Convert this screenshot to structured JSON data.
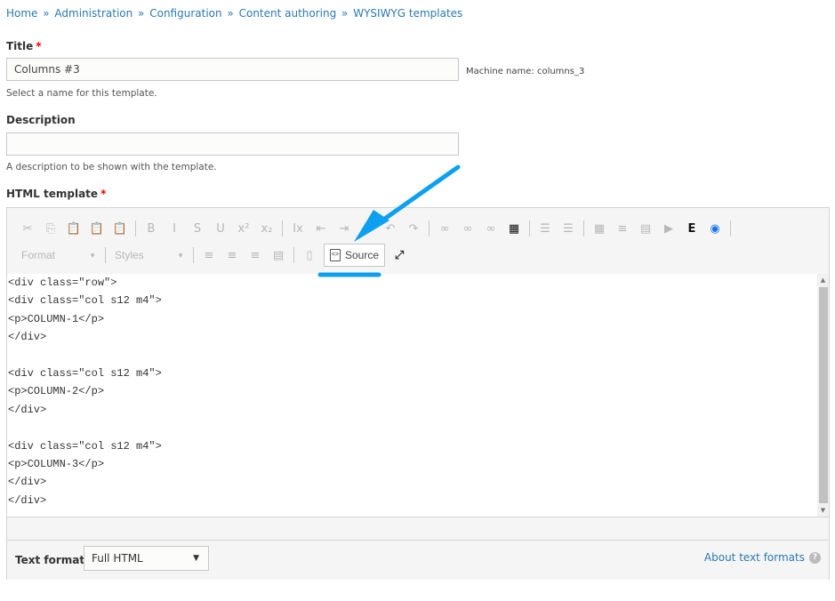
{
  "breadcrumb": [
    {
      "label": "Home"
    },
    {
      "label": "Administration"
    },
    {
      "label": "Configuration"
    },
    {
      "label": "Content authoring"
    },
    {
      "label": "WYSIWYG templates"
    }
  ],
  "breadcrumb_separator": "»",
  "title_field": {
    "label": "Title",
    "required_mark": "*",
    "value": "Columns #3",
    "machine_name": "Machine name: columns_3",
    "help": "Select a name for this template."
  },
  "description_field": {
    "label": "Description",
    "value": "",
    "help": "A description to be shown with the template."
  },
  "html_template": {
    "label": "HTML template",
    "required_mark": "*",
    "toolbar": {
      "row1": [
        {
          "icon": "cut-icon",
          "glyph": "✂"
        },
        {
          "icon": "copy-icon",
          "glyph": "⎘"
        },
        {
          "icon": "paste-icon",
          "glyph": "📋"
        },
        {
          "icon": "paste-text-icon",
          "glyph": "📋"
        },
        {
          "icon": "paste-from-word-icon",
          "glyph": "📋"
        },
        {
          "sep": true
        },
        {
          "icon": "bold-icon",
          "glyph": "B"
        },
        {
          "icon": "italic-icon",
          "glyph": "I"
        },
        {
          "icon": "strikethrough-icon",
          "glyph": "S"
        },
        {
          "icon": "underline-icon",
          "glyph": "U"
        },
        {
          "icon": "superscript-icon",
          "glyph": "x²"
        },
        {
          "icon": "subscript-icon",
          "glyph": "x₂"
        },
        {
          "sep": true
        },
        {
          "icon": "remove-format-icon",
          "glyph": "Ix"
        },
        {
          "icon": "outdent-icon",
          "glyph": "⇤"
        },
        {
          "icon": "indent-icon",
          "glyph": "⇥"
        },
        {
          "icon": "blockquote-icon",
          "glyph": "❞"
        },
        {
          "icon": "undo-icon",
          "glyph": "↶"
        },
        {
          "icon": "redo-icon",
          "glyph": "↷"
        },
        {
          "sep": true
        },
        {
          "icon": "link-icon",
          "glyph": "∞"
        },
        {
          "icon": "unlink-icon",
          "glyph": "∞"
        },
        {
          "icon": "anchor-icon",
          "glyph": "∞"
        },
        {
          "icon": "templates-icon",
          "glyph": "▦",
          "dark": true
        },
        {
          "sep": true
        },
        {
          "icon": "bulleted-list-icon",
          "glyph": "☰"
        },
        {
          "icon": "numbered-list-icon",
          "glyph": "☰"
        },
        {
          "sep": true
        },
        {
          "icon": "table-icon",
          "glyph": "▦"
        },
        {
          "icon": "horizontal-line-icon",
          "glyph": "≡"
        },
        {
          "icon": "div-container-icon",
          "glyph": "▤"
        },
        {
          "icon": "media-embed-icon",
          "glyph": "▶"
        },
        {
          "icon": "entity-embed-icon",
          "glyph": "E",
          "dark": true
        },
        {
          "icon": "video-embed-icon",
          "glyph": "◉",
          "color": true
        },
        {
          "sep": true
        }
      ],
      "format_combo": "Format",
      "styles_combo": "Styles",
      "row2": [
        {
          "icon": "align-left-icon",
          "glyph": "≡"
        },
        {
          "icon": "align-center-icon",
          "glyph": "≡"
        },
        {
          "icon": "align-right-icon",
          "glyph": "≡"
        },
        {
          "icon": "justify-icon",
          "glyph": "▤"
        },
        {
          "sep": true
        },
        {
          "icon": "show-blocks-icon",
          "glyph": "▯"
        }
      ],
      "source_label": "Source",
      "maximize_glyph": "⤢"
    },
    "source_lines": [
      "<div class=\"row\">",
      "<div class=\"col s12 m4\">",
      "<p>COLUMN-1</p>",
      "</div>",
      "",
      "<div class=\"col s12 m4\">",
      "<p>COLUMN-2</p>",
      "</div>",
      "",
      "<div class=\"col s12 m4\">",
      "<p>COLUMN-3</p>",
      "</div>",
      "</div>"
    ],
    "text_format": {
      "label": "Text format",
      "selected": "Full HTML",
      "about_link": "About text formats"
    }
  },
  "annotation": {
    "arrow_color": "#0ea0f0",
    "target": "Source button"
  }
}
